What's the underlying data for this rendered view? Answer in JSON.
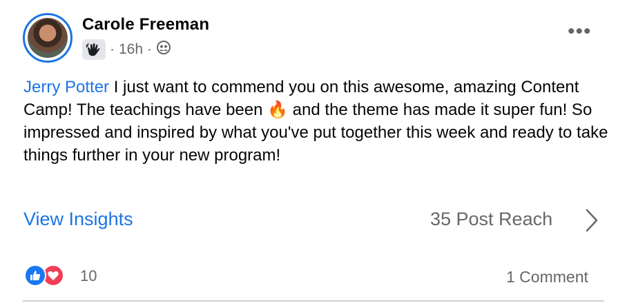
{
  "post": {
    "author": "Carole Freeman",
    "time": "16h",
    "separator": "·",
    "mention": "Jerry Potter",
    "text": " I just want to commend you on this awesome, amazing Content Camp! The teachings have been ",
    "emoji": "🔥",
    "text_after": " and the theme has made it super fun! So impressed and inspired by what you've put together this week and ready to take things further in your new program!"
  },
  "insights": {
    "link_label": "View Insights",
    "reach_label": "35 Post Reach"
  },
  "footer": {
    "reaction_count": "10",
    "comments_label": "1 Comment"
  },
  "icons": {
    "badge": "raised-hand-badge-icon",
    "audience": "group-audience-icon",
    "more": "more-options-icon",
    "chevron": "chevron-right-icon",
    "like": "like-reaction-icon",
    "love": "love-reaction-icon"
  },
  "colors": {
    "accent": "#1b74e4",
    "secondary_text": "#65676b",
    "like": "#1877f2",
    "love": "#f33e58"
  }
}
